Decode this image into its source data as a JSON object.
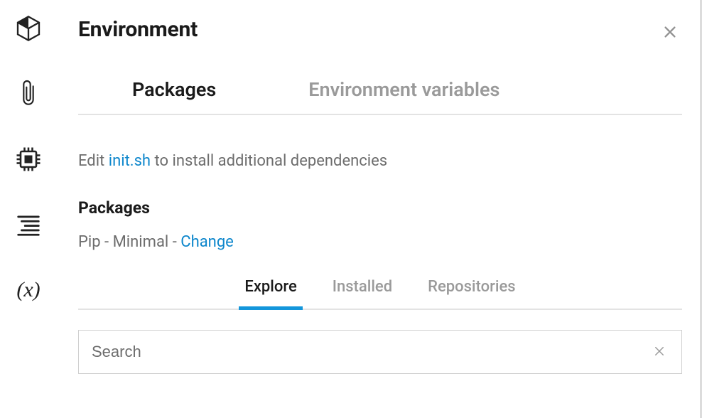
{
  "title": "Environment",
  "tabsPrimary": {
    "packages": "Packages",
    "envvars": "Environment variables"
  },
  "hint": {
    "prefix": "Edit ",
    "link": "init.sh",
    "suffix": " to install additional dependencies"
  },
  "sectionHeading": "Packages",
  "packageLine": {
    "manager": "Pip",
    "separator1": " - ",
    "template": "Minimal",
    "separator2": " - ",
    "changeLabel": "Change"
  },
  "tabsSecondary": {
    "explore": "Explore",
    "installed": "Installed",
    "repositories": "Repositories"
  },
  "search": {
    "placeholder": "Search"
  }
}
